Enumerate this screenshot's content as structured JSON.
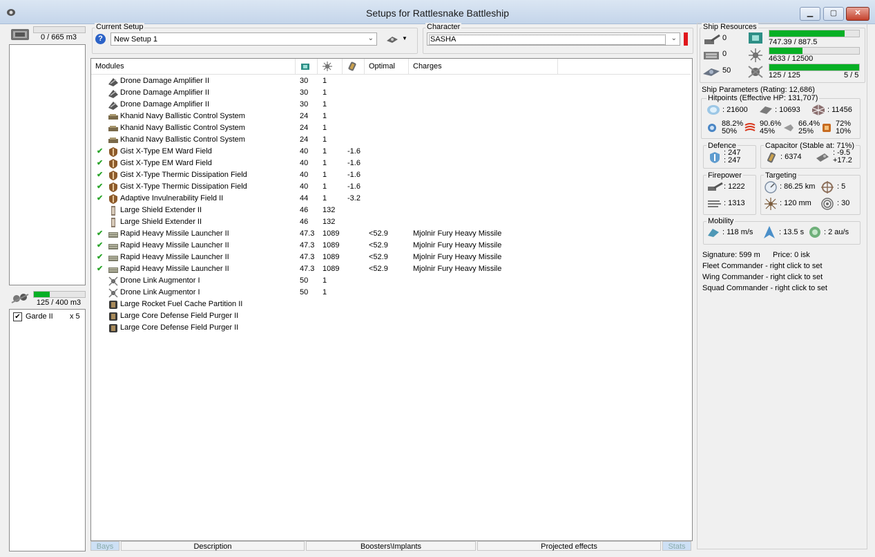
{
  "window": {
    "title": "Setups for Rattlesnake Battleship"
  },
  "cargo": {
    "label": "0 / 665 m3",
    "fill": 0.0
  },
  "drone_bay": {
    "label": "125 / 400 m3",
    "fill": 0.3125,
    "items": [
      {
        "name": "Garde II",
        "count": "x 5",
        "checked": true
      }
    ]
  },
  "current_setup": {
    "group_label": "Current Setup",
    "value": "New Setup 1"
  },
  "character": {
    "group_label": "Character",
    "value": "SASHA"
  },
  "modules": {
    "headers": {
      "name": "Modules",
      "optimal": "Optimal",
      "charges": "Charges"
    },
    "rows": [
      {
        "check": "",
        "icon": "drone-damage-amplifier-icon",
        "name": "Drone Damage Amplifier II",
        "cpu": "30",
        "pg": "1",
        "cap": "",
        "optimal": "",
        "charge": ""
      },
      {
        "check": "",
        "icon": "drone-damage-amplifier-icon",
        "name": "Drone Damage Amplifier II",
        "cpu": "30",
        "pg": "1",
        "cap": "",
        "optimal": "",
        "charge": ""
      },
      {
        "check": "",
        "icon": "drone-damage-amplifier-icon",
        "name": "Drone Damage Amplifier II",
        "cpu": "30",
        "pg": "1",
        "cap": "",
        "optimal": "",
        "charge": ""
      },
      {
        "check": "",
        "icon": "ballistic-control-icon",
        "name": "Khanid Navy Ballistic Control System",
        "cpu": "24",
        "pg": "1",
        "cap": "",
        "optimal": "",
        "charge": ""
      },
      {
        "check": "",
        "icon": "ballistic-control-icon",
        "name": "Khanid Navy Ballistic Control System",
        "cpu": "24",
        "pg": "1",
        "cap": "",
        "optimal": "",
        "charge": ""
      },
      {
        "check": "",
        "icon": "ballistic-control-icon",
        "name": "Khanid Navy Ballistic Control System",
        "cpu": "24",
        "pg": "1",
        "cap": "",
        "optimal": "",
        "charge": ""
      },
      {
        "check": "✔",
        "icon": "ward-field-icon",
        "name": "Gist X-Type EM Ward Field",
        "cpu": "40",
        "pg": "1",
        "cap": "-1.6",
        "optimal": "",
        "charge": ""
      },
      {
        "check": "✔",
        "icon": "ward-field-icon",
        "name": "Gist X-Type EM Ward Field",
        "cpu": "40",
        "pg": "1",
        "cap": "-1.6",
        "optimal": "",
        "charge": ""
      },
      {
        "check": "✔",
        "icon": "ward-field-icon",
        "name": "Gist X-Type Thermic Dissipation Field",
        "cpu": "40",
        "pg": "1",
        "cap": "-1.6",
        "optimal": "",
        "charge": ""
      },
      {
        "check": "✔",
        "icon": "ward-field-icon",
        "name": "Gist X-Type Thermic Dissipation Field",
        "cpu": "40",
        "pg": "1",
        "cap": "-1.6",
        "optimal": "",
        "charge": ""
      },
      {
        "check": "✔",
        "icon": "ward-field-icon",
        "name": "Adaptive Invulnerability Field II",
        "cpu": "44",
        "pg": "1",
        "cap": "-3.2",
        "optimal": "",
        "charge": ""
      },
      {
        "check": "",
        "icon": "shield-extender-icon",
        "name": "Large Shield Extender II",
        "cpu": "46",
        "pg": "132",
        "cap": "",
        "optimal": "",
        "charge": ""
      },
      {
        "check": "",
        "icon": "shield-extender-icon",
        "name": "Large Shield Extender II",
        "cpu": "46",
        "pg": "132",
        "cap": "",
        "optimal": "",
        "charge": ""
      },
      {
        "check": "✔",
        "icon": "missile-launcher-icon",
        "name": "Rapid Heavy Missile Launcher II",
        "cpu": "47.3",
        "pg": "1089",
        "cap": "",
        "optimal": "<52.9",
        "charge": "Mjolnir Fury Heavy Missile"
      },
      {
        "check": "✔",
        "icon": "missile-launcher-icon",
        "name": "Rapid Heavy Missile Launcher II",
        "cpu": "47.3",
        "pg": "1089",
        "cap": "",
        "optimal": "<52.9",
        "charge": "Mjolnir Fury Heavy Missile"
      },
      {
        "check": "✔",
        "icon": "missile-launcher-icon",
        "name": "Rapid Heavy Missile Launcher II",
        "cpu": "47.3",
        "pg": "1089",
        "cap": "",
        "optimal": "<52.9",
        "charge": "Mjolnir Fury Heavy Missile"
      },
      {
        "check": "✔",
        "icon": "missile-launcher-icon",
        "name": "Rapid Heavy Missile Launcher II",
        "cpu": "47.3",
        "pg": "1089",
        "cap": "",
        "optimal": "<52.9",
        "charge": "Mjolnir Fury Heavy Missile"
      },
      {
        "check": "",
        "icon": "drone-link-icon",
        "name": "Drone Link Augmentor I",
        "cpu": "50",
        "pg": "1",
        "cap": "",
        "optimal": "",
        "charge": ""
      },
      {
        "check": "",
        "icon": "drone-link-icon",
        "name": "Drone Link Augmentor I",
        "cpu": "50",
        "pg": "1",
        "cap": "",
        "optimal": "",
        "charge": ""
      },
      {
        "check": "",
        "icon": "rig-icon",
        "name": "Large Rocket Fuel Cache Partition II",
        "cpu": "",
        "pg": "",
        "cap": "",
        "optimal": "",
        "charge": ""
      },
      {
        "check": "",
        "icon": "rig-icon",
        "name": "Large Core Defense Field Purger II",
        "cpu": "",
        "pg": "",
        "cap": "",
        "optimal": "",
        "charge": ""
      },
      {
        "check": "",
        "icon": "rig-icon",
        "name": "Large Core Defense Field Purger II",
        "cpu": "",
        "pg": "",
        "cap": "",
        "optimal": "",
        "charge": ""
      }
    ]
  },
  "tabs": [
    "Bays",
    "Description",
    "Boosters\\Implants",
    "Projected effects",
    "Stats"
  ],
  "resources": {
    "title": "Ship Resources",
    "turret": "0",
    "launcher": "0",
    "calibration": "50",
    "cpu": "747.39 / 887.5",
    "cpu_fill": 0.842,
    "pg": "4633 / 12500",
    "pg_fill": 0.371,
    "drone_bw": "125 / 125",
    "drone_bw_fill": 1.0,
    "drones_active": "5 / 5"
  },
  "params": {
    "title": "Ship Parameters (Rating: 12,686)",
    "hitpoints_title": "Hitpoints (Effective HP: 131,707)",
    "shield_hp": ": 21600",
    "armor_hp": ": 10693",
    "hull_hp": ": 11456",
    "res": [
      {
        "a": "88.2%",
        "b": "50%"
      },
      {
        "a": "90.6%",
        "b": "45%"
      },
      {
        "a": "66.4%",
        "b": "25%"
      },
      {
        "a": "72%",
        "b": "10%"
      }
    ],
    "defence_title": "Defence",
    "def1": ": 247",
    "def2": ": 247",
    "cap_title": "Capacitor (Stable at: 71%)",
    "cap_amount": ": 6374",
    "cap1": ": -9.5",
    "cap2": "+17.2",
    "fire_title": "Firepower",
    "fire1": ": 1222",
    "fire2": ": 1313",
    "targ_title": "Targeting",
    "targ_range": ": 86.25 km",
    "targ_count": ": 5",
    "targ_res": ": 120 mm",
    "targ_scan": ": 30",
    "mob_title": "Mobility",
    "speed": ": 118 m/s",
    "align": ": 13.5 s",
    "warp": ": 2 au/s",
    "signature": "Signature: 599 m",
    "price": "Price: 0 isk",
    "fleet": "Fleet Commander - right click to set",
    "wing": "Wing Commander - right click to set",
    "squad": "Squad Commander - right click to set"
  }
}
